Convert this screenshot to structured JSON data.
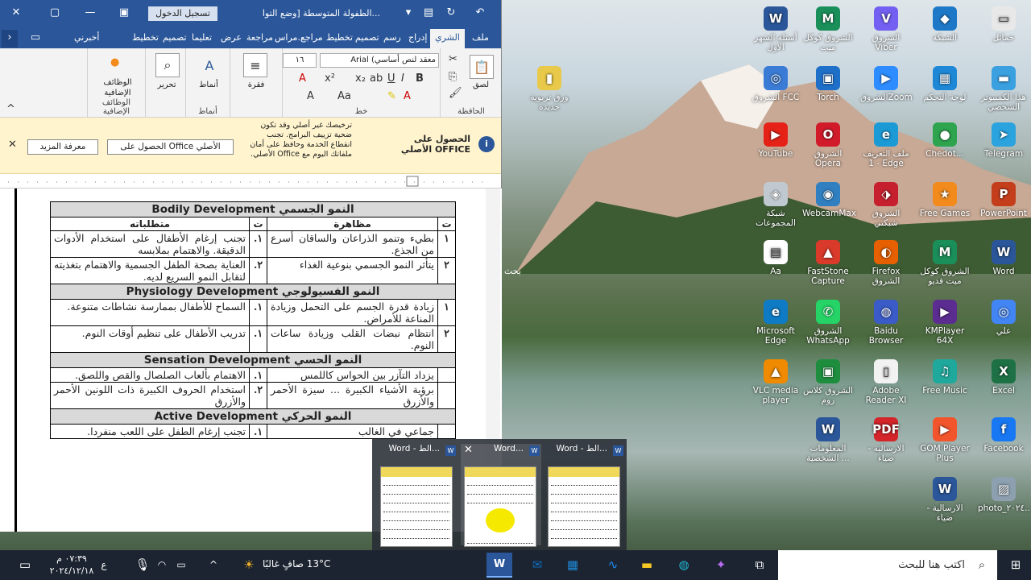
{
  "word": {
    "title": "الطفولة المتوسطة [وضع التوا...",
    "signin": "تسجيل الدخول",
    "tabs": [
      "ملف",
      "الشري",
      "إدراج",
      "رسم",
      "تصميم",
      "تخطيط",
      "مراجع",
      "مراس...",
      "مراجعة",
      "عرض",
      "تعليما",
      "تصميم",
      "تخطيط",
      "أخبرني"
    ],
    "ribbon": {
      "paste": "لصق",
      "clipboard": "الحافظة",
      "font_name": "معقد لنص أساسي) Arial",
      "font_size": "١٦",
      "font": "خط",
      "paragraph": "فقرة",
      "styles": "أنماط",
      "styles_group": "أنماط",
      "editing": "تحرير",
      "addins": "الوظائف الإضافية",
      "addins_group": "الوظائف الإضافية"
    },
    "notice": {
      "heading": "الحصول على OFFICE الأصلي",
      "text": "ترخيصك غير أصلي وقد تكون ضحية تزييف البرامج. تجنب انقطاع الخدمة وحافظ على أمان ملفاتك اليوم مع Office الأصلي.",
      "get_btn": "الحصول على Office الأصلي",
      "more_btn": "معرفة المزيد"
    }
  },
  "doc": {
    "col_t": "ت",
    "col_manifest": "مظاهرة",
    "col_req": "متطلباته",
    "sections": [
      {
        "title": "النمو الجسمي Bodily Development",
        "rows": [
          {
            "n": "١",
            "m": "بطيء وتنمو الذراعان والساقان أسرع من الجذع.",
            "rn": "١.",
            "r": "تجنب إرغام الأطفال على استخدام الأدوات الدقيقة. والاهتمام بملابسه"
          },
          {
            "n": "٢",
            "m": "يتأثر النمو الجسمي بنوعية الغذاء",
            "rn": "٢.",
            "r": "العناية بصحة الطفل الجسمية والاهتمام بتغذيته لتقابل النمو السريع لديه."
          }
        ]
      },
      {
        "title": "النمو الفسيولوجي Physiology Development",
        "rows": [
          {
            "n": "١",
            "m": "زيادة قدرة الجسم على التحمل وزيادة المناعة للأمراض.",
            "rn": "١.",
            "r": "السماح للأطفال بممارسة نشاطات متنوعة."
          },
          {
            "n": "٢",
            "m": "انتظام نبضات القلب وزيادة ساعات النوم.",
            "rn": "١.",
            "r": "تدريب الأطفال على تنظيم أوقات النوم."
          }
        ]
      },
      {
        "title": "النمو الحسي Sensation Development",
        "rows": [
          {
            "n": "",
            "m": "يزداد التآزر بين الحواس كاللمس",
            "rn": "١.",
            "r": "الاهتمام بألعاب الصلصال والقص واللصق."
          },
          {
            "n": "",
            "m": "برؤية الأشياء الكبيرة ... سيزة الأحمر والأزرق",
            "rn": "٢.",
            "r": "استخدام الحروف الكبيرة ذات اللونين الأحمر والأزرق"
          }
        ]
      },
      {
        "title": "النمو الحركي Active Development",
        "rows": [
          {
            "n": "",
            "m": "جماعي في الغالب",
            "rn": "١.",
            "r": "تجنب إرغام الطفل على اللعب منفردا."
          }
        ]
      }
    ]
  },
  "desktop": [
    {
      "label": "أسئلة الشهر الأول",
      "c": "#2b579a",
      "g": "W"
    },
    {
      "label": "الشروق كوكل ميت",
      "c": "#1a8f5a",
      "g": "M"
    },
    {
      "label": "الشروق Viber",
      "c": "#7360f2",
      "g": "V"
    },
    {
      "label": "الشبكة",
      "c": "#1e78c8",
      "g": "◆"
    },
    {
      "label": "خمائل",
      "c": "#e8e8e8",
      "g": "▭"
    },
    {
      "label": "ورق تربوية جديدة",
      "c": "#e8c94a",
      "g": "▮"
    },
    {
      "label": "الشروق FCC",
      "c": "#3a7bd5",
      "g": "◎"
    },
    {
      "label": "Torch",
      "c": "#1e6fc8",
      "g": "▣"
    },
    {
      "label": "الشروقZoom",
      "c": "#2d8cff",
      "g": "▶"
    },
    {
      "label": "لوحة التحكم",
      "c": "#1e88d6",
      "g": "▦"
    },
    {
      "label": "هذا الكمبيوتر الشخصي",
      "c": "#3aa0e0",
      "g": "▬"
    },
    {
      "label": "YouTube",
      "c": "#e62117",
      "g": "▶"
    },
    {
      "label": "الشروق Opera",
      "c": "#d11b2a",
      "g": "O"
    },
    {
      "label": "ملف التعريف 1 - Edge",
      "c": "#1c9ad6",
      "g": "e"
    },
    {
      "label": "Chedot...",
      "c": "#2ea44f",
      "g": "●"
    },
    {
      "label": "Telegram",
      "c": "#2aa3df",
      "g": "➤"
    },
    {
      "label": "شبكة المجموعات",
      "c": "#c0c8d0",
      "g": "◈"
    },
    {
      "label": "WebcamMax",
      "c": "#2f7fc1",
      "g": "◉"
    },
    {
      "label": "الشروق شبكتي",
      "c": "#c6202e",
      "g": "⬗"
    },
    {
      "label": "Free Games",
      "c": "#f28a1c",
      "g": "★"
    },
    {
      "label": "PowerPoint",
      "c": "#c43e1c",
      "g": "P"
    },
    {
      "label": "Aa",
      "c": "#ffffff",
      "g": "▤"
    },
    {
      "label": "FastStone Capture",
      "c": "#d93a2a",
      "g": "▲"
    },
    {
      "label": "Firefox الشروق",
      "c": "#e66000",
      "g": "◐"
    },
    {
      "label": "الشروق كوكل ميت فديو",
      "c": "#1a8f5a",
      "g": "M"
    },
    {
      "label": "Word",
      "c": "#2b579a",
      "g": "W"
    },
    {
      "label": "Microsoft Edge",
      "c": "#0f7bc4",
      "g": "e"
    },
    {
      "label": "الشروق WhatsApp",
      "c": "#25d366",
      "g": "✆"
    },
    {
      "label": "Baidu Browser",
      "c": "#3a5bc8",
      "g": "◍"
    },
    {
      "label": "KMPlayer 64X",
      "c": "#5b2d90",
      "g": "▶"
    },
    {
      "label": "علي",
      "c": "#4285f4",
      "g": "◎"
    },
    {
      "label": "VLC media player",
      "c": "#f08a00",
      "g": "▲"
    },
    {
      "label": "الشروق كلاس روم",
      "c": "#1e8e3e",
      "g": "▣"
    },
    {
      "label": "Adobe Reader XI",
      "c": "#f2f2f2",
      "g": "▯"
    },
    {
      "label": "Free Music",
      "c": "#1fa89c",
      "g": "♫"
    },
    {
      "label": "Excel",
      "c": "#1e7145",
      "g": "X"
    },
    {
      "label": "المعلومات الشخصية ...",
      "c": "#2b579a",
      "g": "W"
    },
    {
      "label": "الارسالية - ضياء",
      "c": "#d4252a",
      "g": "PDF"
    },
    {
      "label": "GOM Player Plus",
      "c": "#f2552c",
      "g": "▶"
    },
    {
      "label": "Facebook",
      "c": "#1877f2",
      "g": "f"
    },
    {
      "label": "الارسالية - ضياء",
      "c": "#2b579a",
      "g": "W"
    },
    {
      "label": "photo_٢٠٢٤...",
      "c": "#8ca0b0",
      "g": "▨"
    }
  ],
  "desktop_side": "بحث",
  "thumbs": [
    {
      "title": "Word - الط..."
    },
    {
      "title": "Word..."
    },
    {
      "title": "Word - الط..."
    }
  ],
  "taskbar": {
    "search": "اكتب هنا للبحث",
    "weather": "13°C صافٍ غالبًا",
    "time": "٠٧:٣٩ م",
    "date": "٢٠٢٤/١٢/١٨",
    "lang": "ع"
  }
}
